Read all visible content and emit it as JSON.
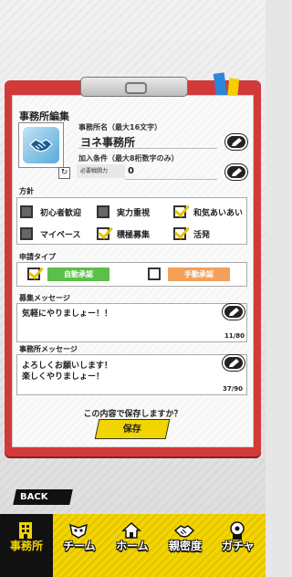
{
  "header": {
    "title": "事務所編集"
  },
  "office": {
    "name_label": "事務所名（最大16文字）",
    "name_value": "ヨネ事務所",
    "req_label": "加入条件（最大8桁数字のみ）",
    "req_field_label": "必要戦闘力",
    "req_value": "0"
  },
  "policy": {
    "label": "方針",
    "options": [
      {
        "label": "初心者歓迎",
        "checked": false
      },
      {
        "label": "実力重視",
        "checked": false
      },
      {
        "label": "和気あいあい",
        "checked": true
      },
      {
        "label": "マイペース",
        "checked": false
      },
      {
        "label": "積極募集",
        "checked": true
      },
      {
        "label": "活発",
        "checked": true
      }
    ]
  },
  "application": {
    "label": "申請タイプ",
    "auto_label": "自動承認",
    "manual_label": "手動承認",
    "selected": "auto"
  },
  "recruit": {
    "label": "募集メッセージ",
    "text": "気軽にやりましょー！！",
    "counter": "11/80"
  },
  "office_message": {
    "label": "事務所メッセージ",
    "line1": "よろしくお願いします！",
    "line2": "楽しくやりましょー！",
    "counter": "37/90"
  },
  "confirm_text": "この内容で保存しますか？",
  "save_label": "保存",
  "back_label": "BACK",
  "nav": {
    "items": [
      {
        "label": "事務所",
        "icon": "building-icon",
        "active": true
      },
      {
        "label": "チーム",
        "icon": "mask-icon",
        "active": false
      },
      {
        "label": "ホーム",
        "icon": "house-icon",
        "active": false
      },
      {
        "label": "親密度",
        "icon": "handshake-icon",
        "active": false
      },
      {
        "label": "ガチャ",
        "icon": "gacha-icon",
        "active": false
      }
    ]
  },
  "colors": {
    "board": "#d23a3a",
    "accent_yellow": "#f3d400",
    "auto_green": "#5cbf49",
    "manual_orange": "#f3a05a"
  }
}
